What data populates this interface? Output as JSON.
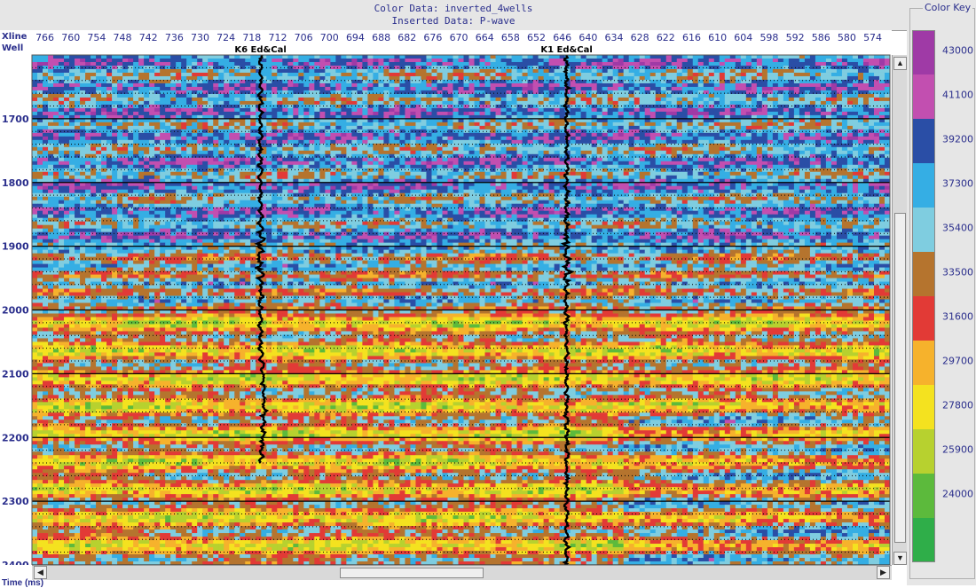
{
  "header": {
    "color_data": "Color Data:  inverted_4wells",
    "inserted_data": "Inserted Data:  P-wave"
  },
  "axis": {
    "xline_label": "Xline",
    "well_label": "Well",
    "time_label": "Time (ms)"
  },
  "chart_data": {
    "type": "heatmap",
    "title": "",
    "x_ticks": [
      766,
      760,
      754,
      748,
      742,
      736,
      730,
      724,
      718,
      712,
      706,
      700,
      694,
      688,
      682,
      676,
      670,
      664,
      658,
      652,
      646,
      640,
      634,
      628,
      622,
      616,
      610,
      604,
      598,
      592,
      586,
      580,
      574
    ],
    "xlim": [
      769,
      570
    ],
    "y_ticks": [
      1700,
      1800,
      1900,
      2000,
      2100,
      2200,
      2300,
      2400
    ],
    "ylim": [
      1600,
      2400
    ],
    "grid": "solid lines every 100 ms, dotted lines every 20 ms",
    "wells": [
      {
        "name": "K6 Ed&Cal",
        "xline": 716
      },
      {
        "name": "K1 Ed&Cal",
        "xline": 645
      }
    ],
    "color_key": {
      "title": "Color Key",
      "levels": [
        {
          "value": 43000,
          "color": "#9f3aa6"
        },
        {
          "value": 41100,
          "color": "#c24fb0"
        },
        {
          "value": 39200,
          "color": "#2a4ea6"
        },
        {
          "value": 37300,
          "color": "#35aee4"
        },
        {
          "value": 35400,
          "color": "#7fcde0"
        },
        {
          "value": 33500,
          "color": "#b5742e"
        },
        {
          "value": 31600,
          "color": "#e23a36"
        },
        {
          "value": 29700,
          "color": "#f6b22c"
        },
        {
          "value": 27800,
          "color": "#f4e21f"
        },
        {
          "value": 25900,
          "color": "#b7d12f"
        },
        {
          "value": 24000,
          "color": "#5cba3c"
        }
      ],
      "bottom_color": "#2fae49"
    }
  }
}
